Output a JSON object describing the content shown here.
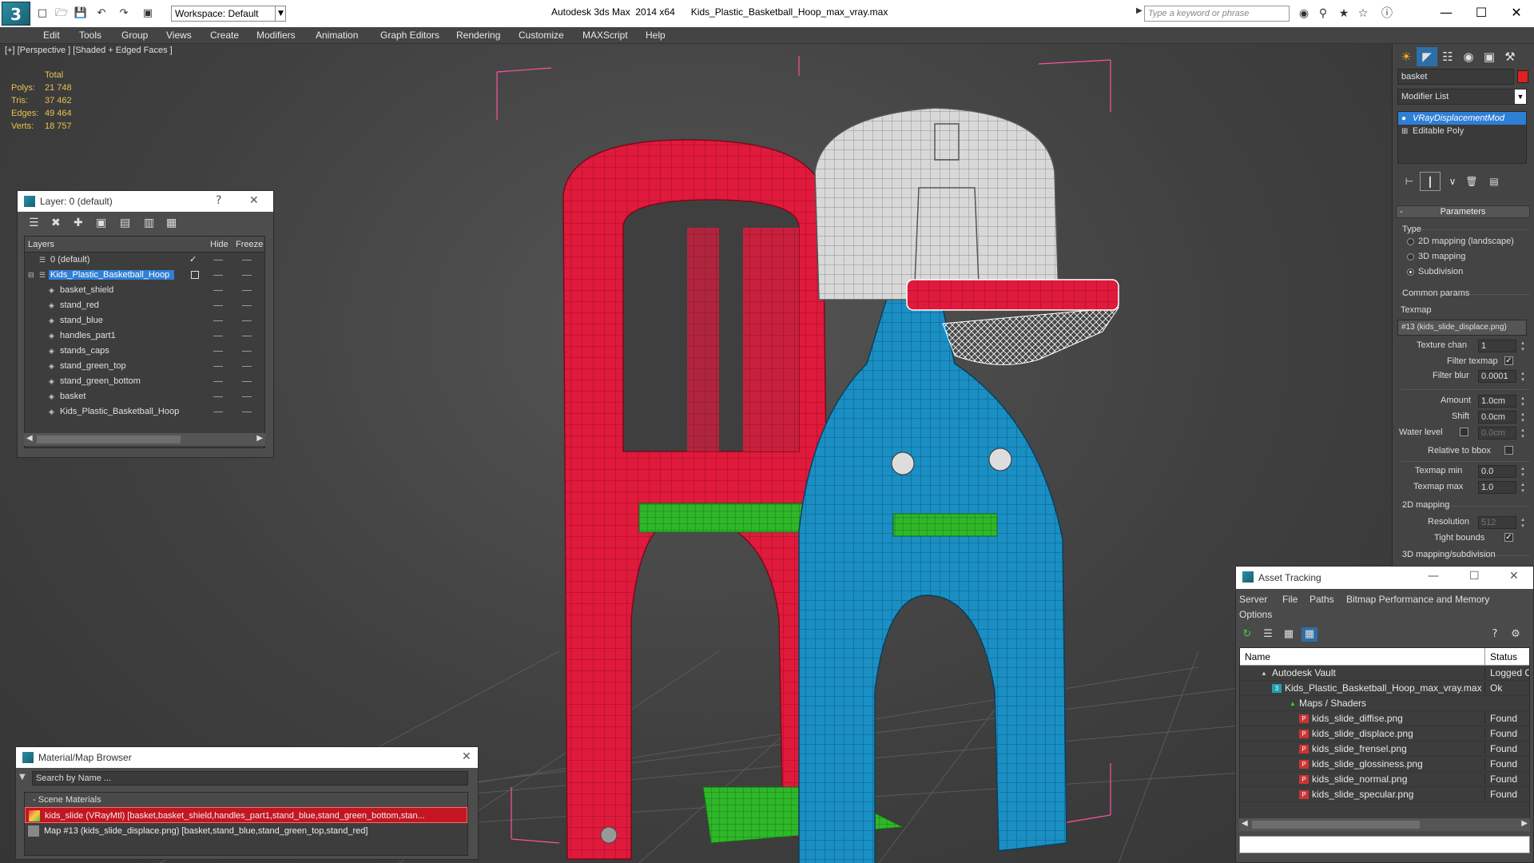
{
  "titlebar": {
    "workspace": "Workspace: Default",
    "app_name": "Autodesk 3ds Max  2014 x64",
    "file_name": "Kids_Plastic_Basketball_Hoop_max_vray.max",
    "search_placeholder": "Type a keyword or phrase"
  },
  "menu": [
    "Edit",
    "Tools",
    "Group",
    "Views",
    "Create",
    "Modifiers",
    "Animation",
    "Graph Editors",
    "Rendering",
    "Customize",
    "MAXScript",
    "Help"
  ],
  "viewport": {
    "label": "[+] [Perspective ] [Shaded + Edged Faces ]",
    "stats": {
      "header": "Total",
      "rows": [
        {
          "k": "Polys:",
          "v": "21 748"
        },
        {
          "k": "Tris:",
          "v": "37 462"
        },
        {
          "k": "Edges:",
          "v": "49 464"
        },
        {
          "k": "Verts:",
          "v": "18 757"
        }
      ]
    },
    "colors": {
      "red": "#e01a3c",
      "blue": "#1a8fc4",
      "green": "#2fb72a",
      "white": "#d8d8d8"
    }
  },
  "layer_panel": {
    "title": "Layer: 0 (default)",
    "help": "?",
    "cols": {
      "layers": "Layers",
      "hide": "Hide",
      "freeze": "Freeze"
    },
    "rows": [
      {
        "name": "0 (default)",
        "level": 0,
        "active": true
      },
      {
        "name": "Kids_Plastic_Basketball_Hoop",
        "level": 0,
        "selected": true
      },
      {
        "name": "basket_shield",
        "level": 1
      },
      {
        "name": "stand_red",
        "level": 1
      },
      {
        "name": "stand_blue",
        "level": 1
      },
      {
        "name": "handles_part1",
        "level": 1
      },
      {
        "name": "stands_caps",
        "level": 1
      },
      {
        "name": "stand_green_top",
        "level": 1
      },
      {
        "name": "stand_green_bottom",
        "level": 1
      },
      {
        "name": "basket",
        "level": 1
      },
      {
        "name": "Kids_Plastic_Basketball_Hoop",
        "level": 1
      }
    ]
  },
  "material_browser": {
    "title": "Material/Map Browser",
    "search_placeholder": "Search by Name ...",
    "section": "- Scene Materials",
    "items": [
      {
        "text": "kids_slide (VRayMtl) [basket,basket_shield,handles_part1,stand_blue,stand_green_bottom,stan...",
        "selected": true
      },
      {
        "text": "Map #13 (kids_slide_displace.png) [basket,stand_blue,stand_green_top,stand_red]",
        "selected": false
      }
    ]
  },
  "command_panel": {
    "object_name": "basket",
    "modifier_list": "Modifier List",
    "stack": [
      "VRayDisplacementMod",
      "Editable Poly"
    ],
    "params_header": "Parameters",
    "type_label": "Type",
    "type_options": [
      {
        "label": "2D mapping (landscape)",
        "on": false
      },
      {
        "label": "3D mapping",
        "on": false
      },
      {
        "label": "Subdivision",
        "on": true
      }
    ],
    "common_params": "Common params",
    "texmap_label": "Texmap",
    "texmap_value": "#13 (kids_slide_displace.png)",
    "texture_chan_label": "Texture chan",
    "texture_chan": "1",
    "filter_texmap": "Filter texmap",
    "filter_blur_label": "Filter blur",
    "filter_blur": "0.0001",
    "amount_label": "Amount",
    "amount": "1.0cm",
    "shift_label": "Shift",
    "shift": "0.0cm",
    "water_level_label": "Water level",
    "water_level": "0.0cm",
    "relative_bbox": "Relative to bbox",
    "texmap_min_label": "Texmap min",
    "texmap_min": "0.0",
    "texmap_max_label": "Texmap max",
    "texmap_max": "1.0",
    "mapping_2d": "2D mapping",
    "resolution_label": "Resolution",
    "resolution": "512",
    "tight_bounds": "Tight bounds",
    "mapping_3d_sub": "3D mapping/subdivision"
  },
  "asset_tracking": {
    "title": "Asset Tracking",
    "menu": [
      "Server",
      "File",
      "Paths",
      "Bitmap Performance and Memory",
      "Options"
    ],
    "cols": {
      "name": "Name",
      "status": "Status"
    },
    "rows": [
      {
        "name": "Autodesk Vault",
        "level": 0,
        "status": "Logged O",
        "icon": "vault"
      },
      {
        "name": "Kids_Plastic_Basketball_Hoop_max_vray.max",
        "level": 1,
        "status": "Ok",
        "icon": "max"
      },
      {
        "name": "Maps / Shaders",
        "level": 2,
        "status": "",
        "icon": "maps"
      },
      {
        "name": "kids_slide_diffise.png",
        "level": 3,
        "status": "Found",
        "icon": "png"
      },
      {
        "name": "kids_slide_displace.png",
        "level": 3,
        "status": "Found",
        "icon": "png"
      },
      {
        "name": "kids_slide_frensel.png",
        "level": 3,
        "status": "Found",
        "icon": "png"
      },
      {
        "name": "kids_slide_glossiness.png",
        "level": 3,
        "status": "Found",
        "icon": "png"
      },
      {
        "name": "kids_slide_normal.png",
        "level": 3,
        "status": "Found",
        "icon": "png"
      },
      {
        "name": "kids_slide_specular.png",
        "level": 3,
        "status": "Found",
        "icon": "png"
      }
    ]
  }
}
